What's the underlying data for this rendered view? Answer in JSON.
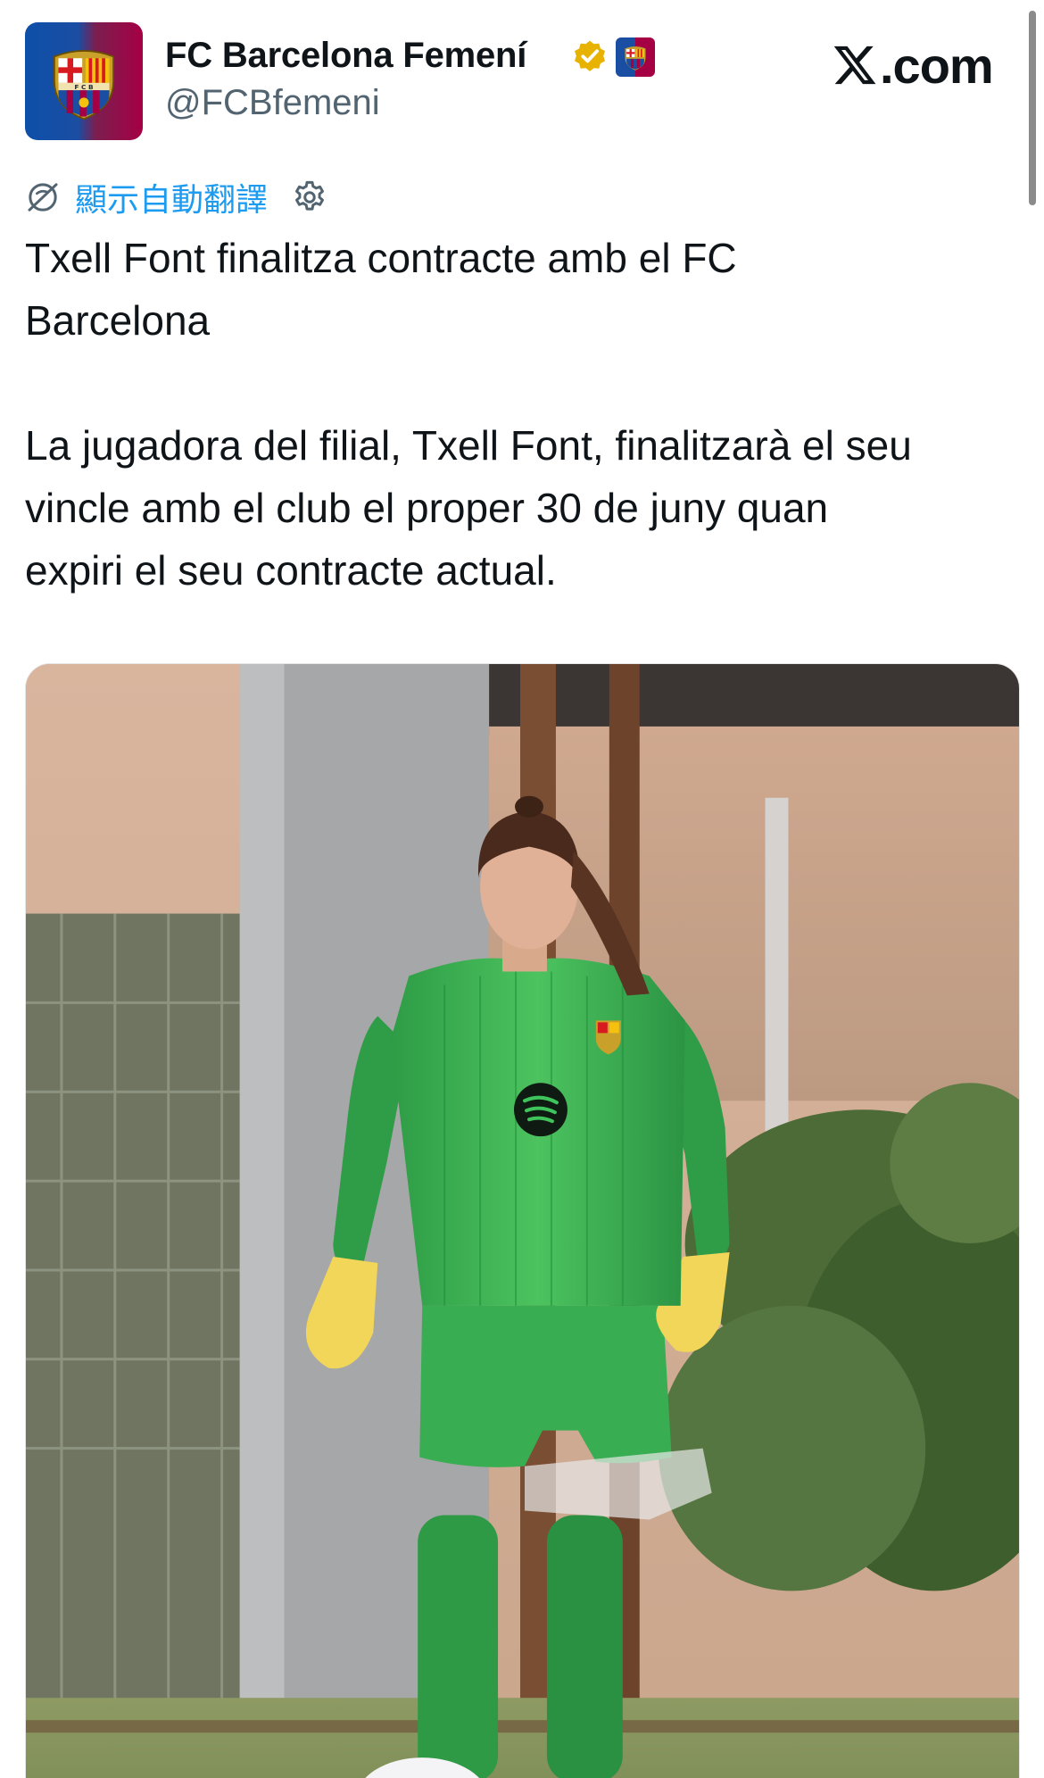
{
  "account": {
    "display_name": "FC Barcelona Femení",
    "handle": "@FCBfemeni",
    "verified": true,
    "avatar": "fc-barcelona-crest",
    "name_emoji": "fc-barcelona-crest-emoji"
  },
  "brand": {
    "logo": "x-logo",
    "suffix": ".com"
  },
  "translate": {
    "icon": "globe-icon",
    "label": "顯示自動翻譯",
    "settings_icon": "gear-icon"
  },
  "tweet": {
    "title": "Txell Font finalitza contracte amb el FC\nBarcelona",
    "body": "La jugadora del filial, Txell Font, finalitzarà el seu\nvincle amb el club el proper 30 de juny quan\nexpiri el seu contracte actual."
  },
  "media": {
    "type": "photo",
    "subject": "goalkeeper-photo"
  },
  "colors": {
    "link": "#1d9bf0",
    "text": "#0f1419",
    "secondary_text": "#536471",
    "verified_badge": "#e8b300",
    "kit_green": "#2fa84f"
  }
}
